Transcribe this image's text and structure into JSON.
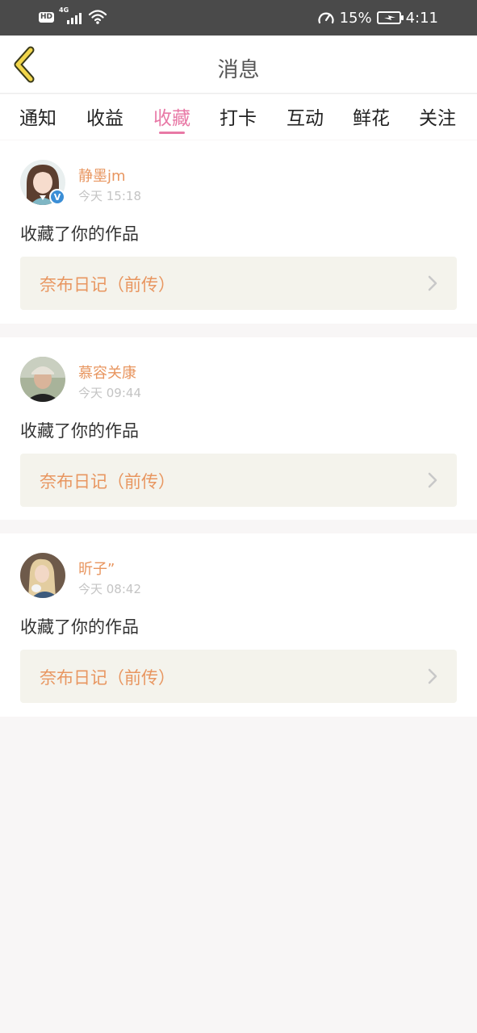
{
  "status_bar": {
    "hd": "HD",
    "network": "4G",
    "battery_percent": "15%",
    "time": "4:11"
  },
  "header": {
    "title": "消息",
    "back_icon": "chevron-left-icon"
  },
  "tabs": [
    {
      "label": "通知",
      "active": false
    },
    {
      "label": "收益",
      "active": false
    },
    {
      "label": "收藏",
      "active": true
    },
    {
      "label": "打卡",
      "active": false
    },
    {
      "label": "互动",
      "active": false
    },
    {
      "label": "鲜花",
      "active": false
    },
    {
      "label": "关注",
      "active": false
    }
  ],
  "messages": [
    {
      "username": "静墨jm",
      "time": "今天 15:18",
      "action": "收藏了你的作品",
      "work": "奈布日记（前传）",
      "verified": true
    },
    {
      "username": "慕容关康",
      "time": "今天 09:44",
      "action": "收藏了你的作品",
      "work": "奈布日记（前传）",
      "verified": false
    },
    {
      "username": "昕子”",
      "time": "今天 08:42",
      "action": "收藏了你的作品",
      "work": "奈布日记（前传）",
      "verified": false
    }
  ],
  "colors": {
    "accent": "#e879a6",
    "username": "#e89660",
    "work_bg": "#f4f3ec",
    "status_bar": "#4a4a4a",
    "back_icon": "#f2d64b"
  }
}
